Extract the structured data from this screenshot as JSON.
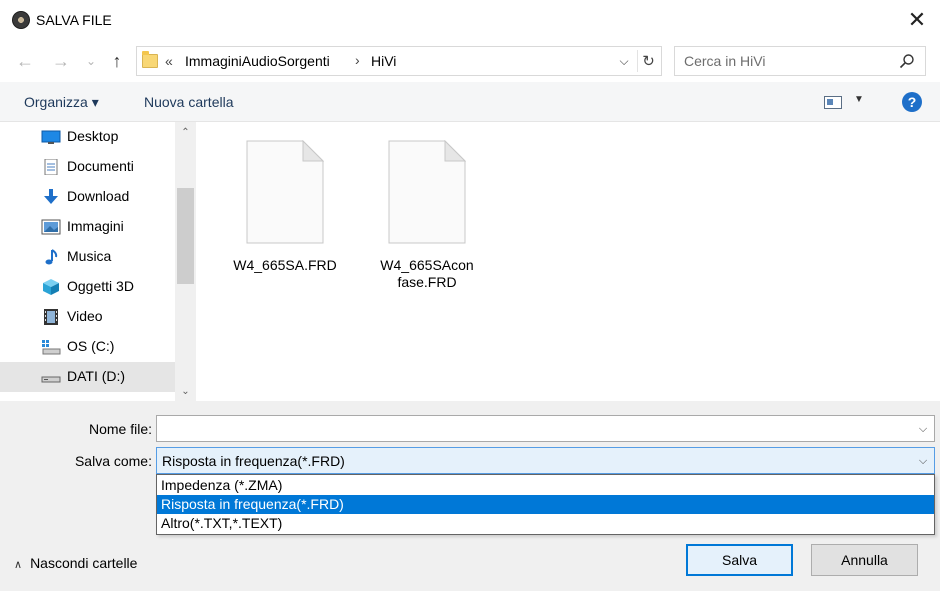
{
  "window": {
    "title": "SALVA FILE",
    "close_glyph": "✕",
    "icon": "disc-icon"
  },
  "nav": {
    "back_glyph": "←",
    "forward_glyph": "→",
    "recent_glyph": "⌄",
    "up_glyph": "↑",
    "breadcrumb_overflow": "«",
    "breadcrumb": [
      "ImmaginiAudioSorgenti",
      "HiVi"
    ],
    "separator": "›",
    "dropdown_glyph": "⌵",
    "refresh_glyph": "↻",
    "search_placeholder": "Cerca in HiVi"
  },
  "commands": {
    "organize": "Organizza ▾",
    "new_folder": "Nuova cartella",
    "view_dd": "▼",
    "help": "?"
  },
  "sidebar": {
    "items": [
      {
        "label": "Desktop",
        "icon": "desktop-icon",
        "selected": false
      },
      {
        "label": "Documenti",
        "icon": "documents-icon",
        "selected": false
      },
      {
        "label": "Download",
        "icon": "download-icon",
        "selected": false
      },
      {
        "label": "Immagini",
        "icon": "pictures-icon",
        "selected": false
      },
      {
        "label": "Musica",
        "icon": "music-icon",
        "selected": false
      },
      {
        "label": "Oggetti 3D",
        "icon": "3d-objects-icon",
        "selected": false
      },
      {
        "label": "Video",
        "icon": "video-icon",
        "selected": false
      },
      {
        "label": "OS (C:)",
        "icon": "os-drive-icon",
        "selected": false
      },
      {
        "label": "DATI (D:)",
        "icon": "drive-icon",
        "selected": true
      }
    ],
    "scroll_up": "⌃",
    "scroll_down": "⌄"
  },
  "files": [
    {
      "name_line1": "W4_665SA.FRD",
      "name_line2": ""
    },
    {
      "name_line1": "W4_665SAcon",
      "name_line2": "fase.FRD"
    }
  ],
  "form": {
    "filename_label": "Nome file:",
    "filename_value": "",
    "savetype_label": "Salva come:",
    "savetype_value": "Risposta in frequenza(*.FRD)",
    "options": [
      {
        "label": "Impedenza (*.ZMA)",
        "highlighted": false
      },
      {
        "label": "Risposta in frequenza(*.FRD)",
        "highlighted": true
      },
      {
        "label": "Altro(*.TXT,*.TEXT)",
        "highlighted": false
      }
    ],
    "dropdown_glyph": "⌵"
  },
  "footer": {
    "hide_folders_chevron": "∧",
    "hide_folders": "Nascondi cartelle",
    "save": "Salva",
    "cancel": "Annulla"
  },
  "colors": {
    "accent": "#0078d7",
    "select_bg": "#e5f1fb",
    "folder": "#f8d775"
  }
}
